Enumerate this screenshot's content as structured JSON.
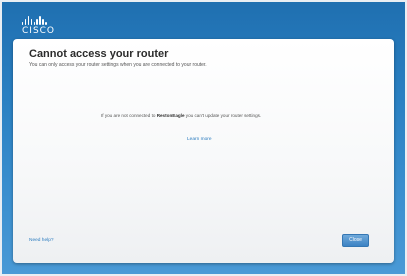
{
  "brand": {
    "logo_text": "CISCO"
  },
  "dialog": {
    "title": "Cannot access your router",
    "subtitle": "You can only access your router settings when you are connected to your router.",
    "message": {
      "before": "If you are not connected to ",
      "network": "RestonEagle",
      "after": " you can't update your router settings."
    },
    "learn_more": "Learn more",
    "need_help": "Need help?",
    "close_label": "Close"
  },
  "colors": {
    "background": "#2a80c2",
    "link": "#2a7bbf",
    "button": "#3d83c4"
  }
}
